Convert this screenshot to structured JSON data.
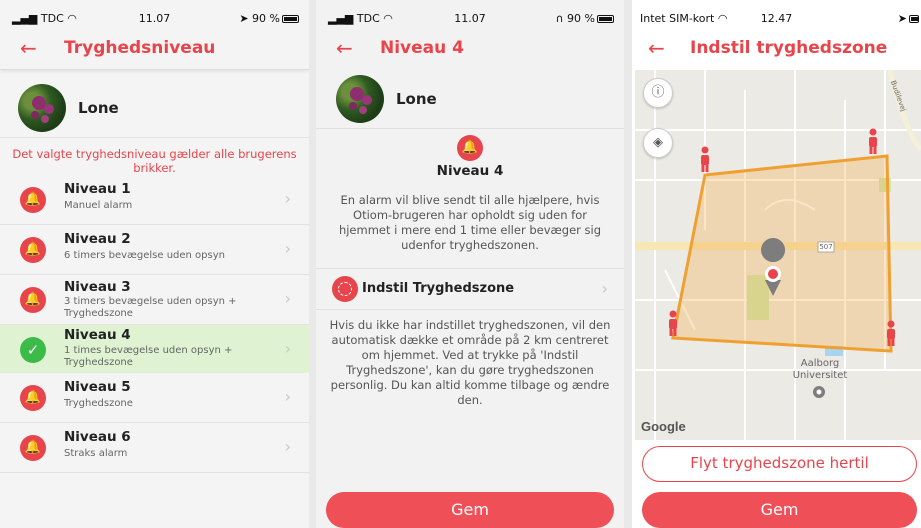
{
  "screen1": {
    "status": {
      "carrier": "TDC",
      "time": "11.07",
      "battery": "90 %"
    },
    "title": "Tryghedsniveau",
    "profile_name": "Lone",
    "warning": "Det valgte tryghedsniveau gælder alle brugerens brikker.",
    "levels": [
      {
        "title": "Niveau 1",
        "subtitle": "Manuel alarm"
      },
      {
        "title": "Niveau 2",
        "subtitle": "6 timers bevægelse uden opsyn"
      },
      {
        "title": "Niveau 3",
        "subtitle": "3 timers bevægelse uden opsyn + Tryghedszone"
      },
      {
        "title": "Niveau 4",
        "subtitle": "1 times bevægelse uden opsyn + Tryghedszone"
      },
      {
        "title": "Niveau 5",
        "subtitle": "Tryghedszone"
      },
      {
        "title": "Niveau 6",
        "subtitle": "Straks alarm"
      }
    ],
    "selected_index": 3
  },
  "screen2": {
    "status": {
      "carrier": "TDC",
      "time": "11.07",
      "battery": "90 %"
    },
    "title": "Niveau 4",
    "profile_name": "Lone",
    "level_title": "Niveau 4",
    "description": "En alarm vil blive sendt til alle hjælpere, hvis Otiom-brugeren har opholdt sig uden for hjemmet i mere end 1 time eller bevæger sig udenfor tryghedszonen.",
    "zone_label": "Indstil Tryghedszone",
    "info": "Hvis du ikke har indstillet tryghedszonen, vil den automatisk dække et område på 2 km centreret om hjemmet. Ved at trykke på 'Indstil Tryghedszone', kan du gøre tryghedszonen personlig. Du kan altid komme tilbage og ændre den.",
    "save_label": "Gem"
  },
  "screen3": {
    "status": {
      "carrier": "Intet SIM-kort",
      "time": "12.47"
    },
    "title": "Indstil tryghedszone",
    "map": {
      "road_label": "507",
      "street_label": "Budilevej",
      "poi_label": "Aalborg Universitet",
      "attribution": "Google"
    },
    "move_label": "Flyt tryghedszone hertil",
    "save_label": "Gem"
  },
  "colors": {
    "accent": "#e8444c",
    "selected_bg": "#dff3d3",
    "check": "#3dbb49",
    "zone_stroke": "#f0a030"
  }
}
